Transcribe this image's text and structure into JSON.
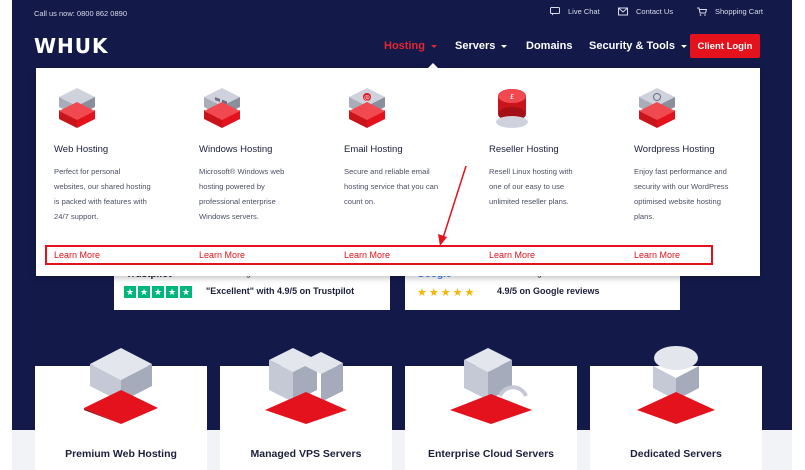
{
  "topbar": {
    "call_text": "Call us now: 0800 862 0890",
    "live_chat": "Live Chat",
    "contact_us": "Contact Us",
    "shopping_cart": "Shopping Cart"
  },
  "header": {
    "logo": "WHUK",
    "nav": [
      {
        "label": "Hosting",
        "active": true
      },
      {
        "label": "Servers",
        "active": false
      },
      {
        "label": "Domains",
        "active": false
      },
      {
        "label": "Security & Tools",
        "active": false
      }
    ],
    "client_login": "Client Login"
  },
  "mega_menu": {
    "columns": [
      {
        "title": "Web Hosting",
        "desc": "Perfect for personal websites, our shared hosting is packed with features with 24/7 support.",
        "learn": "Learn More"
      },
      {
        "title": "Windows Hosting",
        "desc": "Microsoft® Windows web hosting powered by professional enterprise Windows servers.",
        "learn": "Learn More"
      },
      {
        "title": "Email Hosting",
        "desc": "Secure and reliable email hosting service that you can count on.",
        "learn": "Learn More"
      },
      {
        "title": "Reseller Hosting",
        "desc": "Resell Linux hosting with one of our easy to use unlimited reseller plans.",
        "learn": "Learn More"
      },
      {
        "title": "Wordpress Hosting",
        "desc": "Enjoy fast performance and security with our WordPress optimised website hosting plans.",
        "learn": "Learn More"
      }
    ]
  },
  "reviews": {
    "trustpilot": {
      "brand": "Trustpilot",
      "rated": "Webhosting UK is rated",
      "score": "\"Excellent\" with 4.9/5 on Trustpilot"
    },
    "google": {
      "brand": "Google",
      "rated": "Webhosting UK is rated",
      "score": "4.9/5 on Google reviews"
    }
  },
  "cards": [
    {
      "label": "Premium Web Hosting"
    },
    {
      "label": "Managed VPS Servers"
    },
    {
      "label": "Enterprise Cloud Servers"
    },
    {
      "label": "Dedicated Servers"
    }
  ],
  "colors": {
    "navy": "#131a4a",
    "brand_red": "#e3121d",
    "trustpilot_green": "#00b67a",
    "google_star": "#f5b400"
  },
  "icons": {
    "live_chat": "chat-bubble-icon",
    "contact_us": "envelope-icon",
    "shopping_cart": "cart-icon"
  }
}
